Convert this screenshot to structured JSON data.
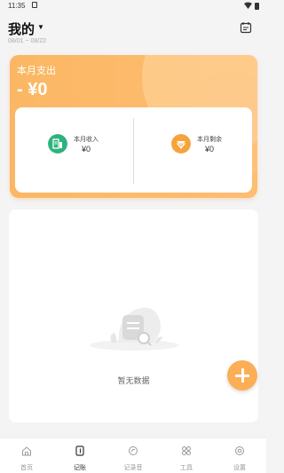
{
  "status_bar": {
    "time": "11:35"
  },
  "header": {
    "book_name": "我的",
    "date_range": "08/01 ~ 08/22"
  },
  "summary": {
    "expense_label": "本月支出",
    "expense_value": "- ¥0",
    "income_label": "本月收入",
    "income_value": "¥0",
    "remaining_label": "本月剩余",
    "remaining_value": "¥0"
  },
  "list": {
    "empty_text": "暂无数据"
  },
  "tabs": [
    {
      "label": "首页",
      "icon": "home-icon"
    },
    {
      "label": "记账",
      "icon": "bookkeeping-icon"
    },
    {
      "label": "记录音",
      "icon": "record-icon"
    },
    {
      "label": "工具",
      "icon": "tools-icon"
    },
    {
      "label": "设置",
      "icon": "settings-icon"
    }
  ],
  "colors": {
    "accent": "#fbb763",
    "income_green": "#2db37d",
    "remaining_orange": "#f6a33b",
    "fab": "#fcae56"
  }
}
